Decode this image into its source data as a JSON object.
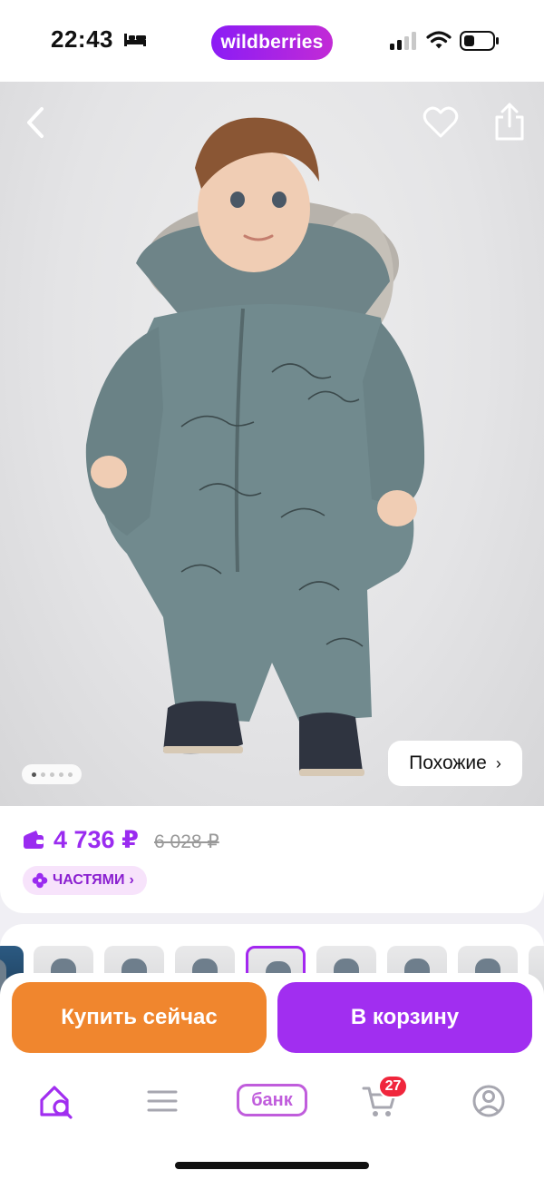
{
  "status_bar": {
    "time": "22:43",
    "brand": "wildberries",
    "icons": [
      "bed-icon",
      "signal-icon",
      "wifi-icon",
      "battery-icon"
    ]
  },
  "product_photo": {
    "top_icons": [
      "back-icon",
      "heart-icon",
      "share-icon"
    ],
    "pagination": {
      "total": 5,
      "active": 1
    },
    "similar_label": "Похожие",
    "similar_chevron": "›"
  },
  "price": {
    "current": "4 736 ₽",
    "old": "6 028 ₽",
    "installments_label": "ЧАСТЯМИ",
    "installments_chevron": "›",
    "accent_color": "#9a2bf0"
  },
  "variants": {
    "count": 9,
    "selected_index": 4
  },
  "actions": {
    "buy_now_label": "Купить сейчас",
    "to_cart_label": "В корзину",
    "buy_now_color": "#f0862e",
    "to_cart_color": "#a12ef0"
  },
  "tab_bar": {
    "bank_label": "банк",
    "cart_badge": "27",
    "items": [
      "home-search-icon",
      "catalog-menu-icon",
      "bank-tab",
      "cart-icon",
      "profile-icon"
    ]
  }
}
